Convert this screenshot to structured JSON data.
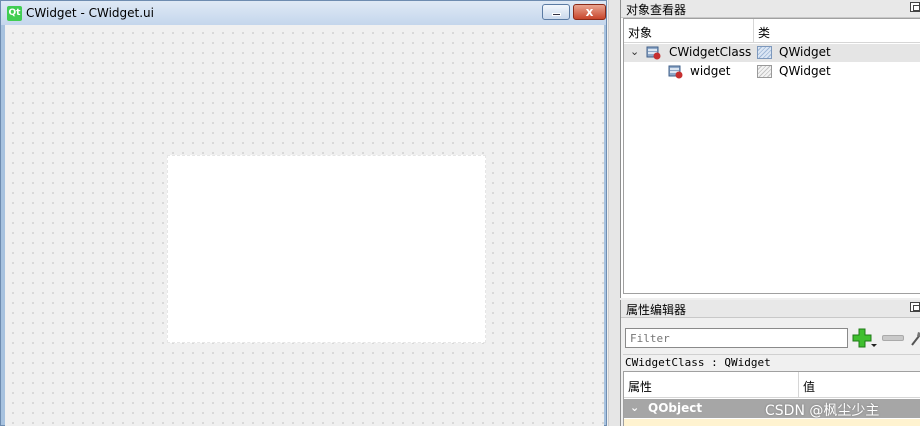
{
  "form_window": {
    "logo": "Qt",
    "title": "CWidget - CWidget.ui",
    "close_glyph": "x",
    "minimize_icon": "minimize-icon",
    "close_icon": "close-icon"
  },
  "object_inspector": {
    "title": "对象查看器",
    "col_object": "对象",
    "col_class": "类",
    "rows": [
      {
        "name": "CWidgetClass",
        "class": "QWidget",
        "expanded": true,
        "selected": true
      },
      {
        "name": "widget",
        "class": "QWidget",
        "expanded": false,
        "selected": false
      }
    ]
  },
  "property_editor": {
    "title": "属性编辑器",
    "filter_placeholder": "Filter",
    "class_caption": "CWidgetClass : QWidget",
    "col_property": "属性",
    "col_value": "值",
    "group": "QObject"
  },
  "watermark": "CSDN @枫尘少主",
  "colors": {
    "accent_green": "#41cd52",
    "group_row": "#a6a6a6",
    "selected_row": "#e5e5e5",
    "titlebar": "#c4d6ec"
  }
}
